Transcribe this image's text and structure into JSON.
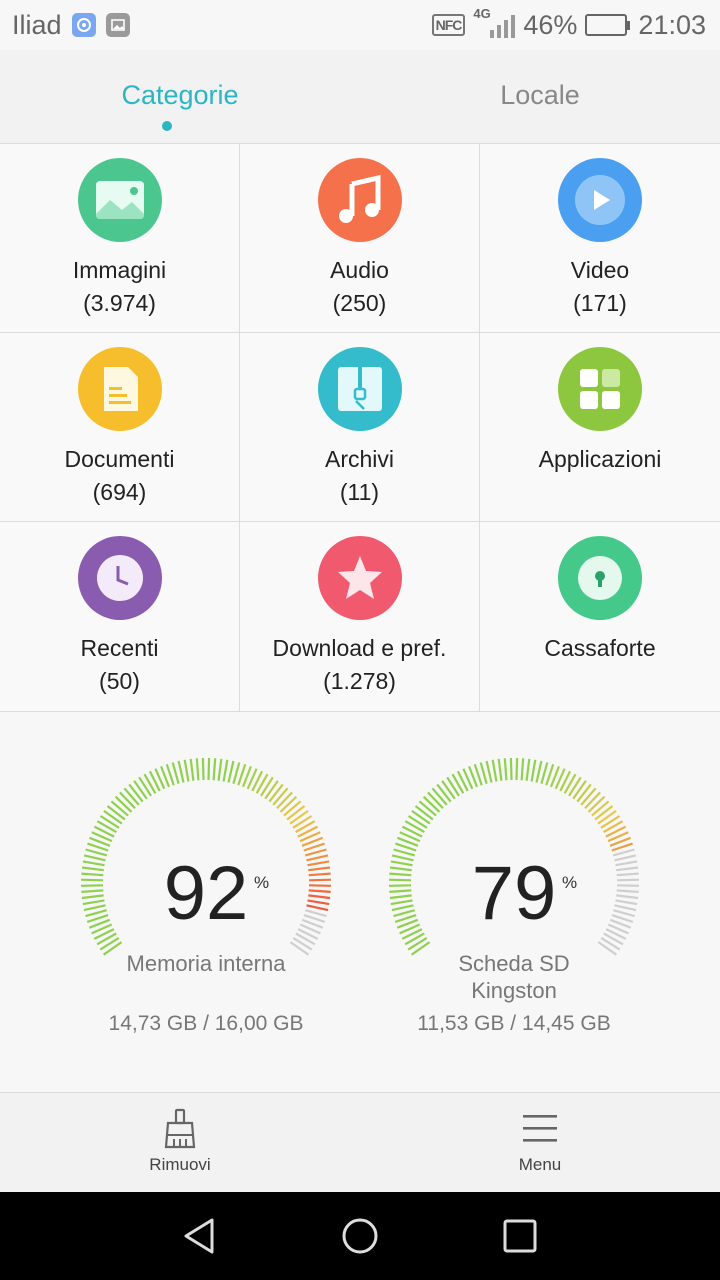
{
  "status_bar": {
    "carrier": "Iliad",
    "nfc_label": "NFC",
    "network_type": "4G",
    "battery_percent": "46%",
    "battery_level": 0.46,
    "time": "21:03"
  },
  "tabs": [
    {
      "label": "Categorie",
      "active": true
    },
    {
      "label": "Locale",
      "active": false
    }
  ],
  "categories": [
    {
      "label": "Immagini",
      "count": "(3.974)",
      "icon": "image-icon",
      "color": "#4cc68f"
    },
    {
      "label": "Audio",
      "count": "(250)",
      "icon": "music-icon",
      "color": "#f5714b"
    },
    {
      "label": "Video",
      "count": "(171)",
      "icon": "play-icon",
      "color": "#4a9ff0"
    },
    {
      "label": "Documenti",
      "count": "(694)",
      "icon": "document-icon",
      "color": "#f6bd2c"
    },
    {
      "label": "Archivi",
      "count": "(11)",
      "icon": "zip-icon",
      "color": "#34bccc"
    },
    {
      "label": "Applicazioni",
      "count": "",
      "icon": "apps-icon",
      "color": "#8dc63f"
    },
    {
      "label": "Recenti",
      "count": "(50)",
      "icon": "clock-icon",
      "color": "#8a5cb0"
    },
    {
      "label": "Download e pref.",
      "count": "(1.278)",
      "icon": "star-icon",
      "color": "#f0596e"
    },
    {
      "label": "Cassaforte",
      "count": "",
      "icon": "lock-icon",
      "color": "#44c98a"
    }
  ],
  "storage": [
    {
      "percent": "92",
      "percent_sign": "%",
      "name": "Memoria interna",
      "size": "14,73 GB / 16,00 GB",
      "fraction": 0.92
    },
    {
      "percent": "79",
      "percent_sign": "%",
      "name": "Scheda SD\nKingston",
      "size": "11,53 GB / 14,45 GB",
      "fraction": 0.79
    }
  ],
  "toolbar": {
    "clean_label": "Rimuovi",
    "menu_label": "Menu"
  },
  "colors": {
    "accent": "#2bb5c5",
    "gauge_green": "#8fd14f",
    "gauge_yellow": "#e8c84a",
    "gauge_red": "#f05a3c",
    "gauge_empty": "#cfcfcf"
  }
}
